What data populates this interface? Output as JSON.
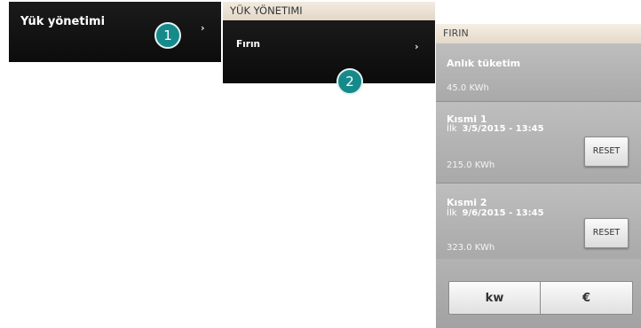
{
  "panel1": {
    "title": "Yük yönetimi",
    "chevron": "›",
    "badge": "1"
  },
  "panel2": {
    "header": "YÜK YÖNETIMI",
    "item_label": "Fırın",
    "chevron": "›",
    "badge": "2"
  },
  "panel3": {
    "header": "FIRIN",
    "instant": {
      "label": "Anlık tüketim",
      "value": "45.0 KWh"
    },
    "partial1": {
      "label": "Kısmi 1",
      "since_word": "İlk",
      "since_date": "3/5/2015 - 13:45",
      "value": "215.0 KWh",
      "reset_label": "RESET"
    },
    "partial2": {
      "label": "Kısmi 2",
      "since_word": "İlk",
      "since_date": "9/6/2015 - 13:45",
      "value": "323.0 KWh",
      "reset_label": "RESET"
    },
    "unit_toggle": {
      "kw_label": "kw",
      "currency_label": "€"
    }
  },
  "colors": {
    "badge": "#168a8a",
    "header_bg": "#efe6d8",
    "dark_panel": "#111111",
    "card_bg": "#b5b5b5"
  },
  "icons": {
    "chevron": "chevron-right-icon"
  }
}
